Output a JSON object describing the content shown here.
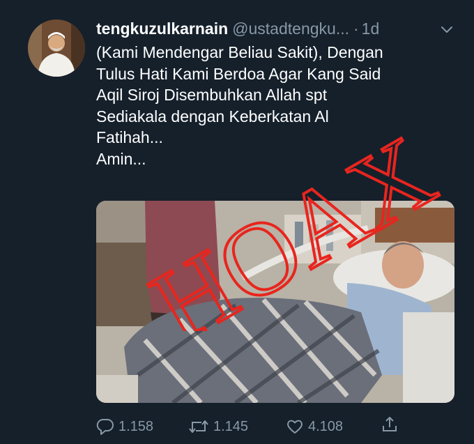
{
  "tweet": {
    "author_name": "tengkuzulkarnain",
    "author_handle": "@ustadtengku...",
    "separator": "·",
    "time": "1d",
    "caret": "∨",
    "lines": [
      "(Kami Mendengar Beliau Sakit), Dengan",
      "Tulus Hati Kami Berdoa Agar Kang Said",
      "Aqil Siroj Disembuhkan Allah spt",
      "Sediakala dengan Keberkatan Al",
      "Fatihah...",
      "Amin..."
    ],
    "watermark": "HOAX",
    "watermark_color": "#e8251e"
  },
  "actions": {
    "replies": "1.158",
    "retweets": "1.145",
    "likes": "4.108"
  },
  "icons": [
    "reply-icon",
    "retweet-icon",
    "like-icon",
    "share-icon",
    "caret-down-icon"
  ],
  "colors": {
    "background": "#15202b",
    "secondary_text": "#8899a6",
    "primary_text": "#ffffff"
  }
}
